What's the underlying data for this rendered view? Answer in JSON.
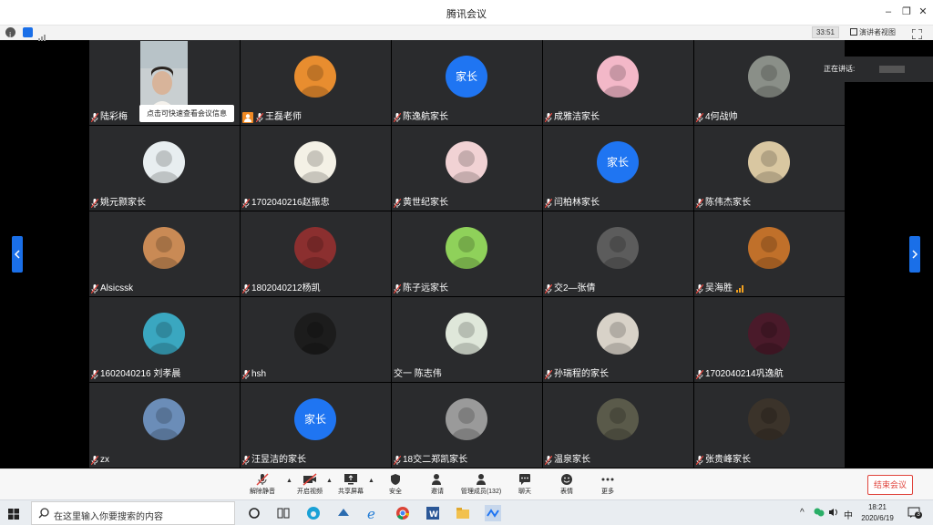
{
  "window": {
    "title": "腾讯会议"
  },
  "infobar": {
    "timer": "33:51",
    "speaker_view": "演讲者视图"
  },
  "tooltip": "点击可快速查看会议信息",
  "speaking": "正在讲话:",
  "participants": [
    {
      "name": "陆彩梅",
      "type": "video"
    },
    {
      "name": "王磊老师",
      "type": "photo",
      "host": true,
      "color": "#e88d2f"
    },
    {
      "name": "陈逸航家长",
      "type": "text",
      "text": "家长"
    },
    {
      "name": "成雅洁家长",
      "type": "photo",
      "color": "#f3b8c8"
    },
    {
      "name": "4何战帅",
      "type": "photo",
      "color": "#8a8f88"
    },
    {
      "name": "姚元颢家长",
      "type": "photo",
      "color": "#e8eef0"
    },
    {
      "name": "1702040216赵振忠",
      "type": "photo",
      "color": "#f4f1e6"
    },
    {
      "name": "黄世纪家长",
      "type": "photo",
      "color": "#f1d2d4"
    },
    {
      "name": "闫柏林家长",
      "type": "text",
      "text": "家长"
    },
    {
      "name": "陈伟杰家长",
      "type": "photo",
      "color": "#d9c7a1"
    },
    {
      "name": "Alsicssk",
      "type": "photo",
      "color": "#c98a55"
    },
    {
      "name": "1802040212杨凯",
      "type": "photo",
      "color": "#8b2f2f"
    },
    {
      "name": "陈子远家长",
      "type": "photo",
      "color": "#8fd15a"
    },
    {
      "name": "交2—张倩",
      "type": "photo",
      "color": "#5c5c5c"
    },
    {
      "name": "吴海胜",
      "type": "photo",
      "signal": true,
      "color": "#c0702a"
    },
    {
      "name": "1602040216 刘孝晨",
      "type": "photo",
      "color": "#3aa7c0"
    },
    {
      "name": "hsh",
      "type": "photo",
      "color": "#1c1c1c"
    },
    {
      "name": "交一 陈志伟",
      "type": "photo",
      "nomic": true,
      "color": "#dfe7da"
    },
    {
      "name": "孙瑞程的家长",
      "type": "photo",
      "color": "#d8d2c8"
    },
    {
      "name": "1702040214巩逸航",
      "type": "photo",
      "color": "#4a1a2a"
    },
    {
      "name": "zx",
      "type": "photo",
      "color": "#6b8db8"
    },
    {
      "name": "汪昱洁的家长",
      "type": "text",
      "text": "家长"
    },
    {
      "name": "18交二郑凯家长",
      "type": "photo",
      "color": "#9a9a9a"
    },
    {
      "name": "温泉家长",
      "type": "photo",
      "color": "#5a5a4a"
    },
    {
      "name": "张贵峰家长",
      "type": "photo",
      "color": "#3b332a"
    }
  ],
  "toolbar": {
    "unmute": "解除静音",
    "video": "开启视频",
    "share": "共享屏幕",
    "security": "安全",
    "invite": "邀请",
    "members": "管理成员(132)",
    "chat": "聊天",
    "reactions": "表情",
    "more": "更多",
    "end": "结束会议"
  },
  "taskbar": {
    "search_placeholder": "在这里输入你要搜索的内容",
    "ime": "中",
    "time": "18:21",
    "date": "2020/6/19",
    "notif_count": "3"
  },
  "colors": {
    "tile": "#2a2b2d",
    "accent": "#1f75f2",
    "end": "#e0443c"
  }
}
